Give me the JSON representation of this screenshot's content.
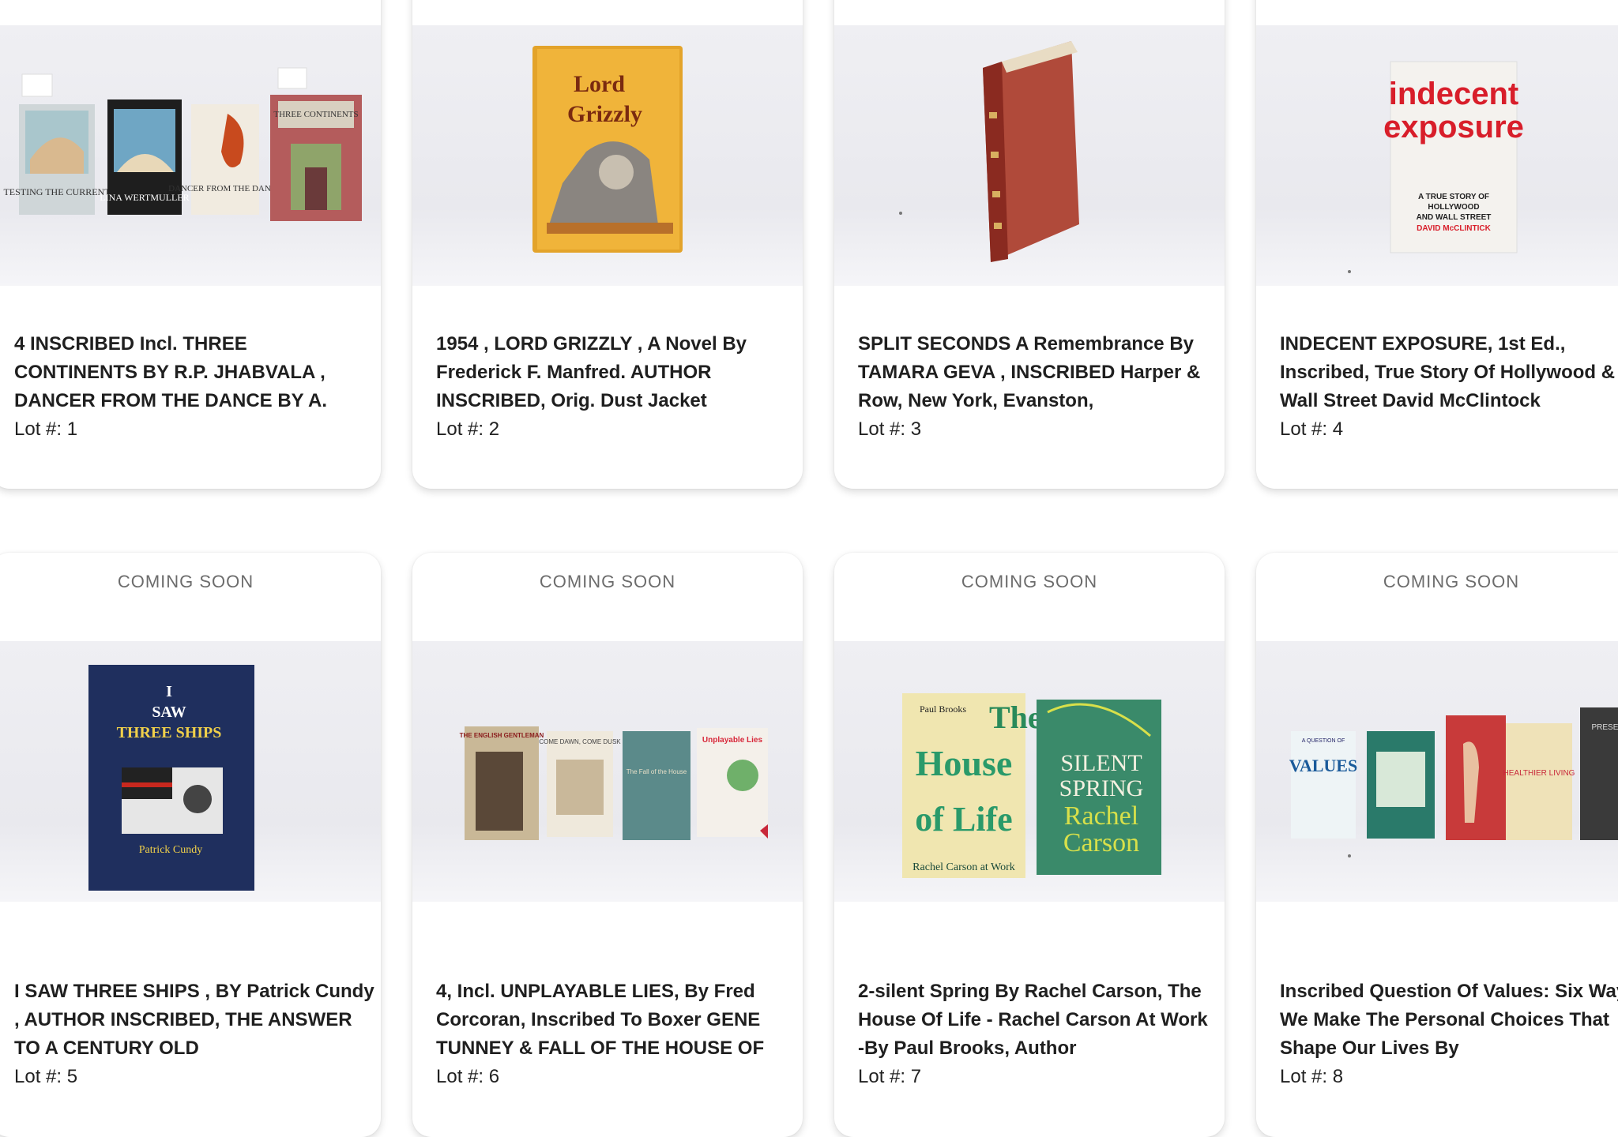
{
  "lots": [
    {
      "title": "4 INSCRIBED Incl. THREE CONTINENTS BY R.P. JHABVALA , DANCER FROM THE DANCE BY A.",
      "lot": "Lot #: 1"
    },
    {
      "title": "1954 , LORD GRIZZLY , A Novel By Frederick F. Manfred. AUTHOR INSCRIBED, Orig. Dust Jacket",
      "lot": "Lot #: 2"
    },
    {
      "title": "SPLIT SECONDS A Remembrance By TAMARA GEVA , INSCRIBED Harper & Row, New York, Evanston,",
      "lot": "Lot #: 3"
    },
    {
      "title": "INDECENT EXPOSURE, 1st Ed., Inscribed, True Story Of Hollywood & Wall Street David McClintock",
      "lot": "Lot #: 4"
    },
    {
      "status": "COMING SOON",
      "title": "I SAW THREE SHIPS , BY Patrick Cundy , AUTHOR INSCRIBED, THE ANSWER TO A CENTURY OLD",
      "lot": "Lot #: 5"
    },
    {
      "status": "COMING SOON",
      "title": "4, Incl. UNPLAYABLE LIES, By Fred Corcoran, Inscribed To Boxer GENE TUNNEY & FALL OF THE HOUSE OF",
      "lot": "Lot #: 6"
    },
    {
      "status": "COMING SOON",
      "title": "2-silent Spring By Rachel Carson, The House Of Life - Rachel Carson At Work -By Paul Brooks, Author",
      "lot": "Lot #: 7"
    },
    {
      "status": "COMING SOON",
      "title": "Inscribed Question Of Values: Six Ways We Make The Personal Choices That Shape Our Lives By",
      "lot": "Lot #: 8"
    }
  ],
  "book_art": {
    "lot1": [
      "TESTING THE CURRENT",
      "LINA WERTMULLER",
      "DANCER FROM THE DANCE",
      "THREE CONTINENTS"
    ],
    "lot2": [
      "Lord",
      "Grizzly"
    ],
    "lot4": [
      "indecent",
      "exposure",
      "A TRUE STORY OF",
      "HOLLYWOOD",
      "AND WALL STREET",
      "DAVID McCLINTICK"
    ],
    "lot5": [
      "I",
      "SAW",
      "THREE SHIPS",
      "Patrick Cundy"
    ],
    "lot6": [
      "THE ENGLISH GENTLEMAN",
      "COME DAWN, COME DUSK",
      "The Fall of the House",
      "Unplayable Lies"
    ],
    "lot7": [
      "Paul Brooks",
      "The",
      "House",
      "of Life",
      "Rachel Carson at Work",
      "SILENT",
      "SPRING",
      "Rachel",
      "Carson"
    ],
    "lot8": [
      "A QUESTION OF",
      "VALUES",
      "HEALTHIER LIVING",
      "PRESENCE"
    ]
  }
}
